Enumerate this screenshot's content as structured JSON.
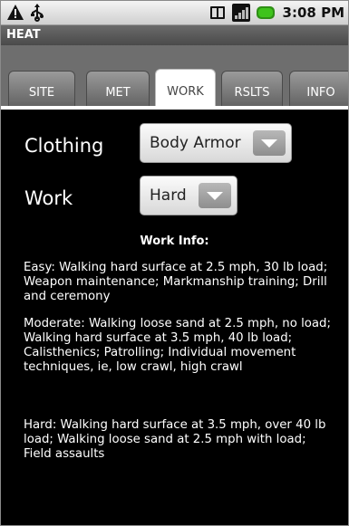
{
  "status_bar": {
    "time": "3:08 PM",
    "icons": [
      "warning-icon",
      "usb-icon",
      "sim-card-icon",
      "signal-icon",
      "battery-icon"
    ]
  },
  "title_bar": {
    "title": "HEAT"
  },
  "tabs": [
    {
      "label": "SITE",
      "active": false
    },
    {
      "label": "MET",
      "active": false
    },
    {
      "label": "WORK",
      "active": true
    },
    {
      "label": "RSLTS",
      "active": false
    },
    {
      "label": "INFO",
      "active": false
    }
  ],
  "form": {
    "clothing": {
      "label": "Clothing",
      "value": "Body Armor"
    },
    "work": {
      "label": "Work",
      "value": "Hard"
    }
  },
  "work_info": {
    "title": "Work Info:",
    "easy": "Easy: Walking hard surface at 2.5 mph, 30 lb load; Weapon maintenance; Markmanship training; Drill and ceremony",
    "moderate": "Moderate: Walking loose sand at 2.5 mph, no load; Walking hard surface at 3.5 mph, 40 lb load; Calisthenics; Patrolling; Individual movement techniques, ie, low crawl, high crawl",
    "hard": "Hard: Walking hard surface at 3.5 mph, over 40 lb load; Walking loose sand at 2.5 mph with load; Field assaults"
  },
  "colors": {
    "background": "#000000",
    "battery": "#3fc31c",
    "title_bar": "#5a5a5a"
  }
}
